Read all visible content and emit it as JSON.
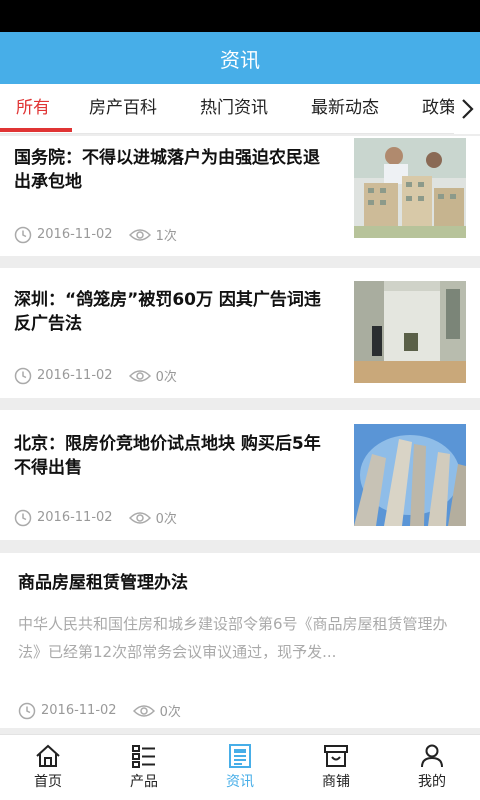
{
  "header": {
    "title": "资讯"
  },
  "tabs": [
    {
      "label": "所有"
    },
    {
      "label": "房产百科"
    },
    {
      "label": "热门资讯"
    },
    {
      "label": "最新动态"
    },
    {
      "label": "政策"
    }
  ],
  "news": [
    {
      "title": "国务院：不得以进城落户为由强迫农民退出承包地",
      "date": "2016-11-02",
      "views": "1次"
    },
    {
      "title": "深圳：“鸽笼房”被罚60万 因其广告词违反广告法",
      "date": "2016-11-02",
      "views": "0次"
    },
    {
      "title": "北京：限房价竞地价试点地块 购买后5年不得出售",
      "date": "2016-11-02",
      "views": "0次"
    },
    {
      "title": "商品房屋租赁管理办法",
      "summary": "中华人民共和国住房和城乡建设部令第6号《商品房屋租赁管理办法》已经第12次部常务会议审议通过，现予发...",
      "date": "2016-11-02",
      "views": "0次"
    }
  ],
  "bottom_nav": [
    {
      "label": "首页",
      "icon": "home-icon"
    },
    {
      "label": "产品",
      "icon": "list-icon"
    },
    {
      "label": "资讯",
      "icon": "news-icon"
    },
    {
      "label": "商铺",
      "icon": "shop-icon"
    },
    {
      "label": "我的",
      "icon": "user-icon"
    }
  ],
  "colors": {
    "header": "#47aee8",
    "active_tab": "#e03434",
    "active_nav": "#47aee8"
  }
}
